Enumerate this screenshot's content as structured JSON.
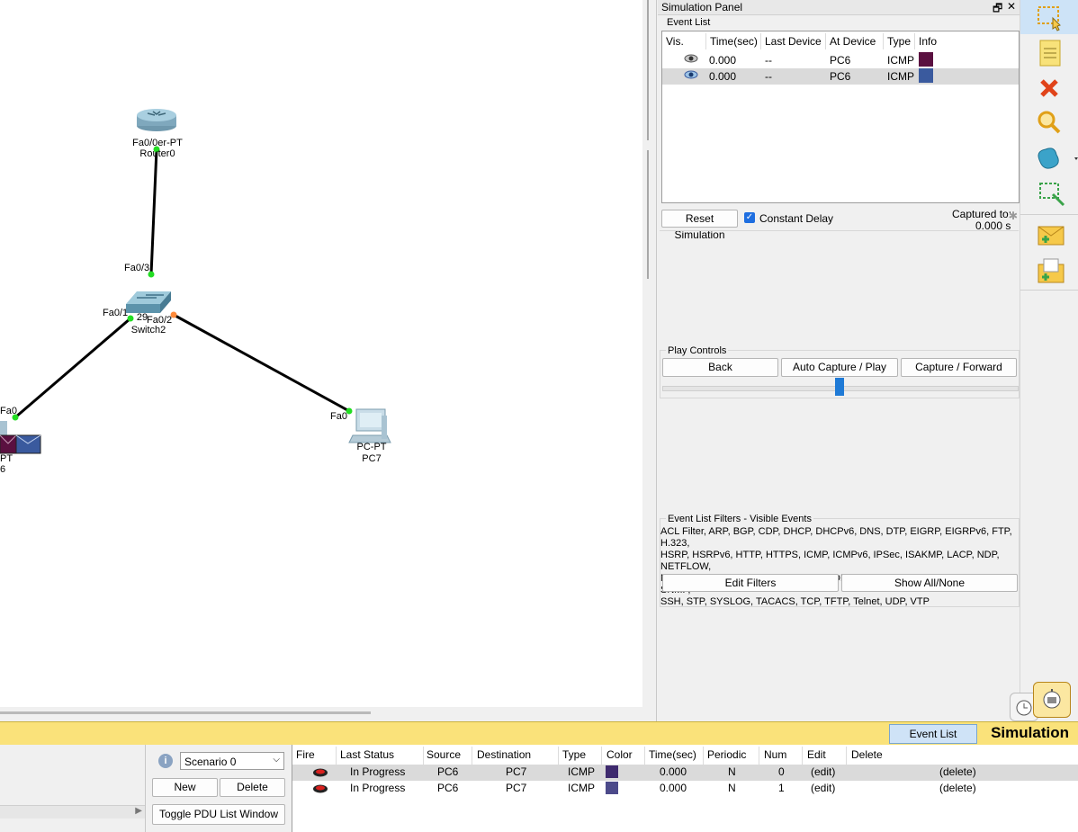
{
  "topology": {
    "router": {
      "model": "Fa0/0er-PT",
      "name": "Router0"
    },
    "switch": {
      "model": "29",
      "name": "Switch2"
    },
    "pc7": {
      "model": "PC-PT",
      "name": "PC7"
    },
    "pc6_partial": {
      "model": "PT",
      "name": "6"
    },
    "ports": {
      "sw_fa03": "Fa0/3",
      "sw_fa01": "Fa0/1",
      "sw_fa02": "Fa0/2",
      "pc6_fa0": "Fa0",
      "pc7_fa0": "Fa0"
    }
  },
  "sim_panel": {
    "title": "Simulation Panel",
    "restore_icon": "🗗",
    "close_icon": "✕",
    "event_list": {
      "title": "Event List",
      "headers": [
        "Vis.",
        "Time(sec)",
        "Last Device",
        "At Device",
        "Type",
        "Info"
      ],
      "rows": [
        {
          "time": "0.000",
          "last": "--",
          "at": "PC6",
          "type": "ICMP",
          "color": "#5a1040"
        },
        {
          "time": "0.000",
          "last": "--",
          "at": "PC6",
          "type": "ICMP",
          "color": "#3a5a9e"
        }
      ]
    },
    "reset_label": "Reset Simulation",
    "constant_delay_label": "Constant Delay",
    "captured_label": "Captured to:",
    "captured_value": "0.000 s",
    "play_controls": {
      "title": "Play Controls",
      "back": "Back",
      "auto": "Auto Capture / Play",
      "forward": "Capture / Forward"
    },
    "filters": {
      "title": "Event List Filters - Visible Events",
      "lines": [
        "ACL Filter, ARP, BGP, CDP, DHCP, DHCPv6, DNS, DTP, EIGRP, EIGRPv6, FTP, H.323,",
        "HSRP, HSRPv6, HTTP, HTTPS, ICMP, ICMPv6, IPSec, ISAKMP, LACP, NDP, NETFLOW,",
        "NTP, OSPF, OSPFv6, PAgP, POP3, RADIUS, RIP, RIPng, RTP, SCCP, SMTP, SNMP,",
        "SSH, STP, SYSLOG, TACACS, TCP, TFTP, Telnet, UDP, VTP"
      ],
      "edit": "Edit Filters",
      "show_all": "Show All/None"
    }
  },
  "bottom": {
    "event_list_btn": "Event List",
    "mode": "Simulation",
    "scenario": "Scenario 0",
    "new": "New",
    "delete": "Delete",
    "toggle": "Toggle PDU List Window",
    "pdu_headers": [
      "Fire",
      "Last Status",
      "Source",
      "Destination",
      "Type",
      "Color",
      "Time(sec)",
      "Periodic",
      "Num",
      "Edit",
      "Delete"
    ],
    "pdu_rows": [
      {
        "status": "In Progress",
        "source": "PC6",
        "dest": "PC7",
        "type": "ICMP",
        "color": "#3e2a6e",
        "time": "0.000",
        "periodic": "N",
        "num": "0",
        "edit": "(edit)",
        "delete": "(delete)"
      },
      {
        "status": "In Progress",
        "source": "PC6",
        "dest": "PC7",
        "type": "ICMP",
        "color": "#4c4a8a",
        "time": "0.000",
        "periodic": "N",
        "num": "1",
        "edit": "(edit)",
        "delete": "(delete)"
      }
    ]
  }
}
